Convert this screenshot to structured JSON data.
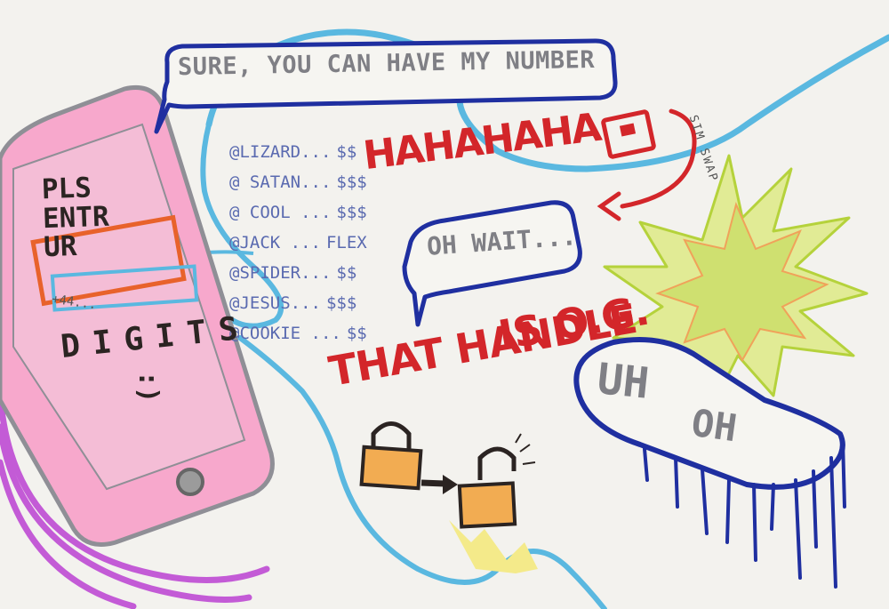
{
  "speech_bubbles": {
    "sure": "SURE, YOU CAN HAVE MY NUMBER",
    "wait": "OH WAIT...",
    "uh_oh_line_1": "UH",
    "uh_oh_line_2": "OH"
  },
  "phone": {
    "title": "PLS\nENTR\nUR",
    "input_value": "+44...",
    "caption": "DIGITS",
    "smiley": ":)"
  },
  "handles": [
    {
      "name": "@LIZARD...",
      "price": "$$"
    },
    {
      "name": "@ SATAN...",
      "price": "$$$"
    },
    {
      "name": "@ COOL ...",
      "price": "$$$"
    },
    {
      "name": "@JACK ...",
      "price": "FLEX"
    },
    {
      "name": "@SPIDER...",
      "price": "$$"
    },
    {
      "name": "@JESUS...",
      "price": "$$$"
    },
    {
      "name": "@COOKIE ...",
      "price": "$$"
    }
  ],
  "laugh": "HAHAHAHA",
  "sim_swap_label": "SIM SWAP",
  "handle_statement": {
    "line_1": "THAT HANDLE",
    "line_2": "IS O.G."
  },
  "icons": [
    "phone-icon",
    "sim-card-icon",
    "padlock-locked-icon",
    "arrow-right-icon",
    "padlock-unlocked-icon",
    "explosion-icon"
  ],
  "colors": {
    "marker_red": "#d3262a",
    "bubble_blue": "#1f2fa0",
    "cable_cyan": "#5ab8e0",
    "phone_pink": "#f39bc6",
    "phone_purple": "#c35bd6",
    "input_orange": "#e8622b",
    "burst_green": "#cfe070",
    "lock_orange": "#f2ac52"
  }
}
